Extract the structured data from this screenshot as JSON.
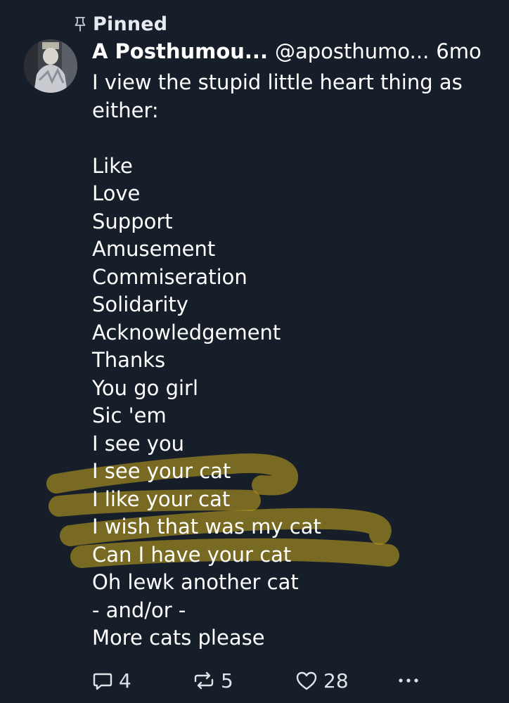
{
  "pinned": {
    "label": "Pinned",
    "icon": "pin-icon"
  },
  "post": {
    "author": {
      "display_name": "A Posthumou...",
      "handle": "@aposthumo...",
      "time": "6mo",
      "avatar": "avatar-photo"
    },
    "lines": [
      "I view the stupid little heart thing as",
      "either:",
      "",
      "Like",
      "Love",
      "Support",
      "Amusement",
      "Commiseration",
      "Solidarity",
      "Acknowledgement",
      "Thanks",
      "You go girl",
      "Sic 'em",
      "I see you",
      "I see your cat",
      "I like your cat",
      "I wish that was my cat",
      "Can I have your cat",
      "Oh lewk another cat",
      "- and/or -",
      "More cats please"
    ],
    "highlighted_lines": [
      "I see your cat",
      "I like your cat",
      "I wish that was my cat",
      "Can I have your cat"
    ],
    "highlight_color": "#b59a1f"
  },
  "actions": {
    "replies": {
      "icon": "reply-icon",
      "count": "4"
    },
    "reposts": {
      "icon": "repost-icon",
      "count": "5"
    },
    "likes": {
      "icon": "heart-icon",
      "count": "28"
    },
    "more": {
      "icon": "more-icon"
    }
  },
  "colors": {
    "background": "#161e29",
    "text": "#ffffff",
    "muted": "#dfe3e8"
  }
}
